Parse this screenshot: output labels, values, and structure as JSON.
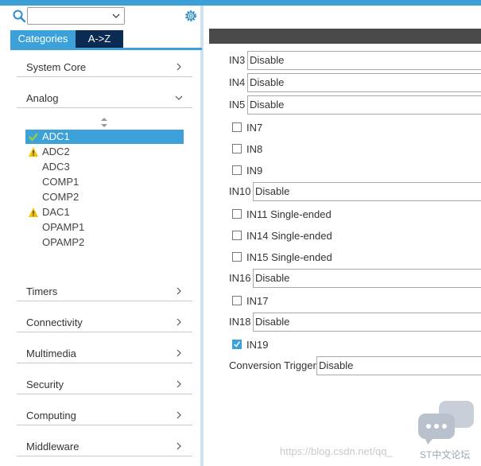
{
  "sidebar": {
    "search": {
      "value": "",
      "placeholder": ""
    },
    "tabs": [
      {
        "label": "Categories"
      },
      {
        "label": "A->Z"
      }
    ],
    "categories": [
      {
        "label": "System Core"
      },
      {
        "label": "Analog"
      },
      {
        "label": "Timers"
      },
      {
        "label": "Connectivity"
      },
      {
        "label": "Multimedia"
      },
      {
        "label": "Security"
      },
      {
        "label": "Computing"
      },
      {
        "label": "Middleware"
      }
    ],
    "analog_items": [
      {
        "label": "ADC1",
        "status": "check"
      },
      {
        "label": "ADC2",
        "status": "warning"
      },
      {
        "label": "ADC3",
        "status": ""
      },
      {
        "label": "COMP1",
        "status": ""
      },
      {
        "label": "COMP2",
        "status": ""
      },
      {
        "label": "DAC1",
        "status": "warning"
      },
      {
        "label": "OPAMP1",
        "status": ""
      },
      {
        "label": "OPAMP2",
        "status": ""
      }
    ]
  },
  "config": {
    "rows": [
      {
        "label": "IN3",
        "value": "Disable"
      },
      {
        "label": "IN4",
        "value": "Disable"
      },
      {
        "label": "IN5",
        "value": "Disable"
      },
      {
        "label": "IN7",
        "checked": false
      },
      {
        "label": "IN8",
        "checked": false
      },
      {
        "label": "IN9",
        "checked": false
      },
      {
        "label": "IN10",
        "value": "Disable"
      },
      {
        "label": "IN11 Single-ended",
        "checked": false
      },
      {
        "label": "IN14 Single-ended",
        "checked": false
      },
      {
        "label": "IN15 Single-ended",
        "checked": false
      },
      {
        "label": "IN16",
        "value": "Disable"
      },
      {
        "label": "IN17",
        "checked": false
      },
      {
        "label": "IN18",
        "value": "Disable"
      },
      {
        "label": "IN19",
        "checked": true
      },
      {
        "label": "Conversion Trigger",
        "value": "Disable"
      }
    ]
  },
  "watermark": {
    "url_text": "https://blog.csdn.net/qq_",
    "brand_text": "ST中文论坛"
  },
  "colors": {
    "accent": "#3ba1d8",
    "tab_dark": "#0b2c52",
    "header_bar": "#4a4a4a",
    "warning": "#f2c200",
    "check": "#8cc63f"
  }
}
